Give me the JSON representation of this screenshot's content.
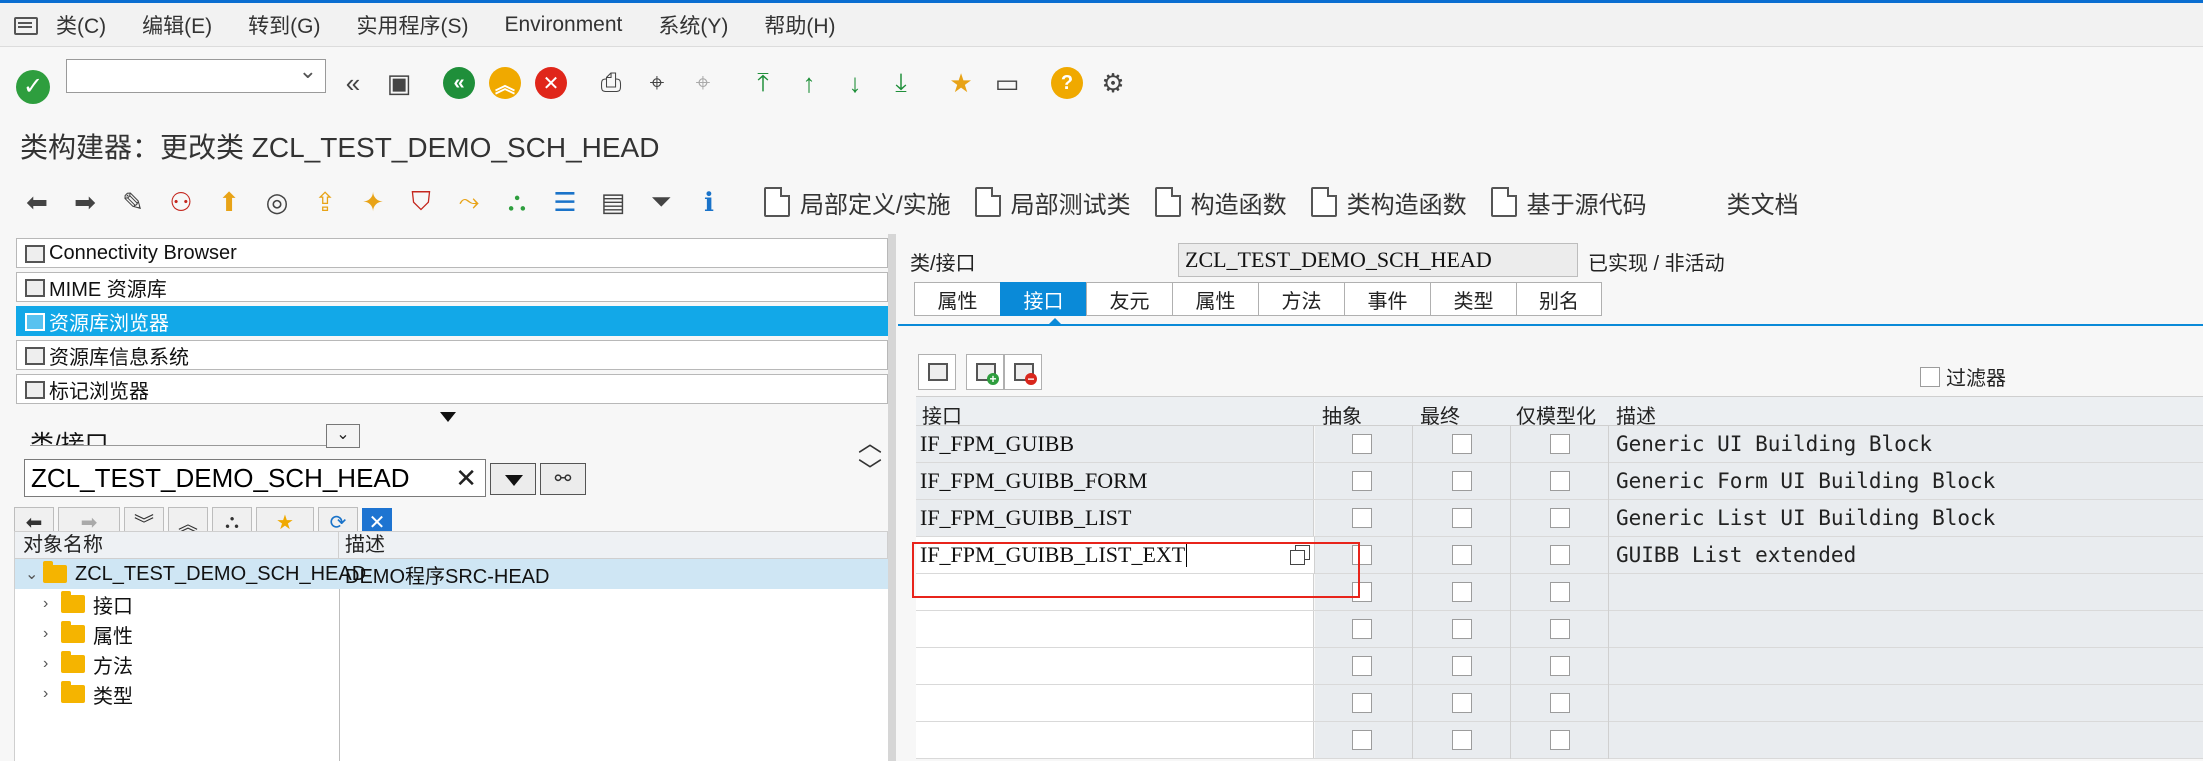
{
  "menubar": {
    "items": [
      "类(C)",
      "编辑(E)",
      "转到(G)",
      "实用程序(S)",
      "Environment",
      "系统(Y)",
      "帮助(H)"
    ]
  },
  "title": "类构建器：更改类 ZCL_TEST_DEMO_SCH_HEAD",
  "app_toolbar": {
    "buttons": [
      "局部定义/实施",
      "局部测试类",
      "构造函数",
      "类构造函数",
      "基于源代码",
      "类文档"
    ]
  },
  "left_nav": {
    "items": [
      "Connectivity Browser",
      "MIME 资源库",
      "资源库浏览器",
      "资源库信息系统",
      "标记浏览器"
    ],
    "selected_index": 2
  },
  "object_selector": {
    "type_label": "类/接口",
    "object_name": "ZCL_TEST_DEMO_SCH_HEAD"
  },
  "tree": {
    "columns": [
      "对象名称",
      "描述"
    ],
    "root": {
      "name": "ZCL_TEST_DEMO_SCH_HEAD",
      "description": "DEMO程序SRC-HEAD"
    },
    "children": [
      "接口",
      "属性",
      "方法",
      "类型"
    ]
  },
  "class_header": {
    "label": "类/接口",
    "name": "ZCL_TEST_DEMO_SCH_HEAD",
    "status": "已实现 / 非活动"
  },
  "tabs": [
    "属性",
    "接口",
    "友元",
    "属性",
    "方法",
    "事件",
    "类型",
    "别名"
  ],
  "active_tab": 1,
  "filter_label": "过滤器",
  "grid": {
    "columns": [
      "接口",
      "抽象",
      "最终",
      "仅模型化",
      "描述"
    ],
    "rows": [
      {
        "name": "IF_FPM_GUIBB",
        "desc": "Generic UI Building Block"
      },
      {
        "name": "IF_FPM_GUIBB_FORM",
        "desc": "Generic Form UI Building Block"
      },
      {
        "name": "IF_FPM_GUIBB_LIST",
        "desc": "Generic List UI Building Block"
      },
      {
        "name": "IF_FPM_GUIBB_LIST_EXT",
        "desc": "GUIBB List extended"
      }
    ]
  },
  "colors": {
    "accent": "#0a8ad8",
    "selection": "#12a8e8",
    "highlight_box": "#e8241b"
  }
}
